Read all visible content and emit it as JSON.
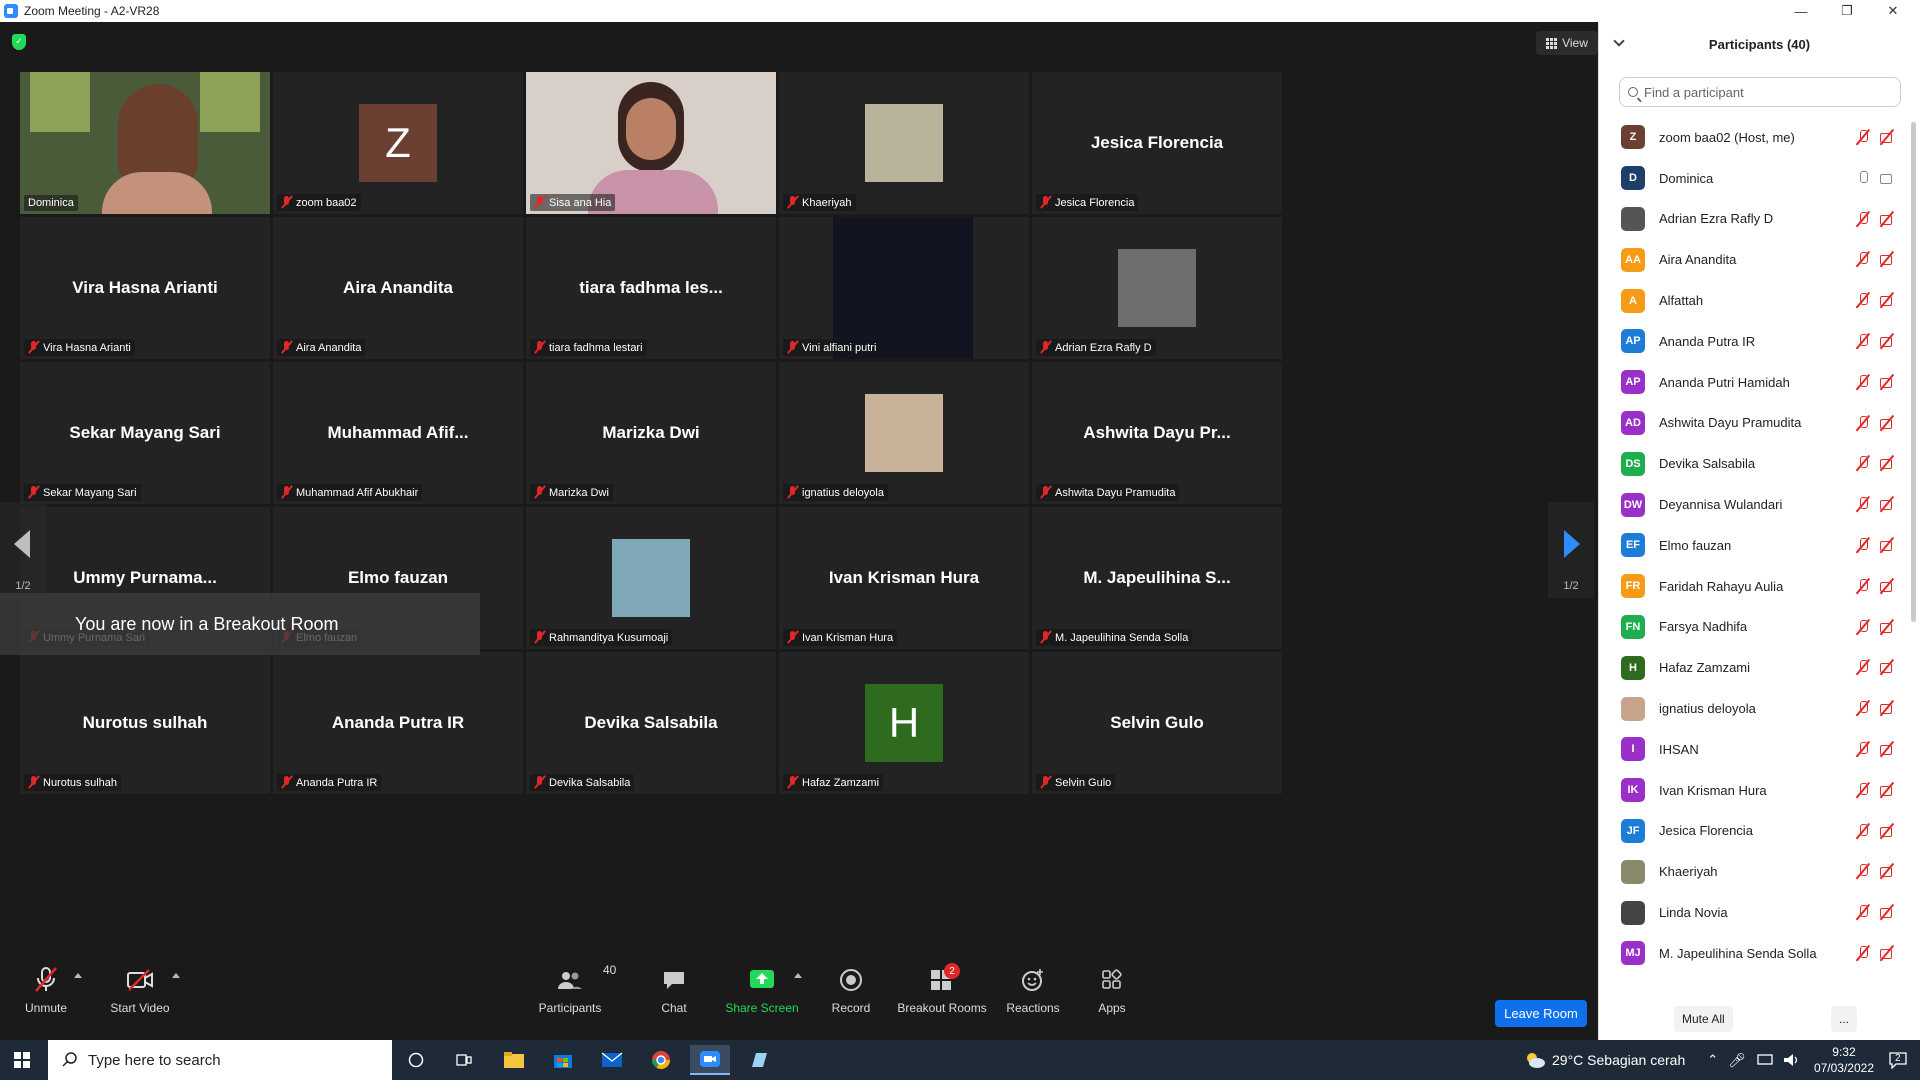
{
  "window": {
    "title": "Zoom Meeting - A2-VR28"
  },
  "meeting": {
    "view_label": "View",
    "page_indicator": "1/2",
    "toast": "You are now in a Breakout Room",
    "tiles": [
      {
        "big": "",
        "name": "Dominica",
        "kind": "video",
        "bg": "#4a5b3a",
        "active": true,
        "muted": false
      },
      {
        "big": "",
        "name": "zoom baa02",
        "kind": "letter",
        "letter": "Z",
        "bg": "#6b4033"
      },
      {
        "big": "",
        "name": "Sisa ana Hia",
        "kind": "video",
        "bg": "#d8cfc9"
      },
      {
        "big": "",
        "name": "Khaeriyah",
        "kind": "photo",
        "bg": "#b9b39c"
      },
      {
        "big": "Jesica Florencia",
        "name": "Jesica Florencia"
      },
      {
        "big": "Vira Hasna Arianti",
        "name": "Vira Hasna Arianti"
      },
      {
        "big": "Aira Anandita",
        "name": "Aira Anandita"
      },
      {
        "big": "tiara fadhma les...",
        "name": "tiara fadhma lestari"
      },
      {
        "big": "",
        "name": "Vini alfiani putri",
        "kind": "dark",
        "bg": "#121421"
      },
      {
        "big": "",
        "name": "Adrian Ezra Rafly D",
        "kind": "photo",
        "bg": "#6e6e6e"
      },
      {
        "big": "Sekar Mayang Sari",
        "name": "Sekar Mayang Sari"
      },
      {
        "big": "Muhammad  Afif...",
        "name": "Muhammad Afif Abukhair"
      },
      {
        "big": "Marizka Dwi",
        "name": "Marizka Dwi"
      },
      {
        "big": "",
        "name": "ignatius deloyola",
        "kind": "photo",
        "bg": "#c8b29a"
      },
      {
        "big": "Ashwita Dayu Pr...",
        "name": "Ashwita Dayu Pramudita"
      },
      {
        "big": "Ummy  Purnama...",
        "name": "Ummy Purnama Sari"
      },
      {
        "big": "Elmo fauzan",
        "name": "Elmo fauzan"
      },
      {
        "big": "",
        "name": "Rahmanditya Kusumoaji",
        "kind": "photo",
        "bg": "#7fa8b8"
      },
      {
        "big": "Ivan Krisman Hura",
        "name": "Ivan Krisman Hura"
      },
      {
        "big": "M. Japeulihina S...",
        "name": "M. Japeulihina Senda Solla"
      },
      {
        "big": "Nurotus sulhah",
        "name": "Nurotus sulhah"
      },
      {
        "big": "Ananda Putra IR",
        "name": "Ananda Putra IR"
      },
      {
        "big": "Devika Salsabila",
        "name": "Devika Salsabila"
      },
      {
        "big": "",
        "name": "Hafaz Zamzami",
        "kind": "letter",
        "letter": "H",
        "bg": "#2e6b1e"
      },
      {
        "big": "Selvin Gulo",
        "name": "Selvin Gulo"
      }
    ]
  },
  "toolbar": {
    "unmute": "Unmute",
    "start_video": "Start Video",
    "participants": "Participants",
    "participants_count": "40",
    "chat": "Chat",
    "share_screen": "Share Screen",
    "record": "Record",
    "breakout_rooms": "Breakout Rooms",
    "breakout_badge": "2",
    "reactions": "Reactions",
    "apps": "Apps",
    "leave_room": "Leave Room",
    "share_color": "#23d959",
    "leave_color": "#0e71eb"
  },
  "panel": {
    "title": "Participants (40)",
    "search_placeholder": "Find a participant",
    "mute_all": "Mute All",
    "more": "...",
    "participants": [
      {
        "initials": "Z",
        "name": "zoom baa02 (Host, me)",
        "color": "#6b4033",
        "status": "muted"
      },
      {
        "initials": "D",
        "name": "Dominica",
        "color": "#1f3f6b",
        "status": "on"
      },
      {
        "initials": "",
        "name": "Adrian Ezra Rafly D",
        "color": "#555555",
        "status": "muted",
        "photo": true
      },
      {
        "initials": "AA",
        "name": "Aira Anandita",
        "color": "#f59b16",
        "status": "muted"
      },
      {
        "initials": "A",
        "name": "Alfattah",
        "color": "#f59b16",
        "status": "muted"
      },
      {
        "initials": "AP",
        "name": "Ananda Putra IR",
        "color": "#1d7cd6",
        "status": "muted"
      },
      {
        "initials": "AP",
        "name": "Ananda Putri Hamidah",
        "color": "#9b30c9",
        "status": "muted"
      },
      {
        "initials": "AD",
        "name": "Ashwita Dayu Pramudita",
        "color": "#9b30c9",
        "status": "muted"
      },
      {
        "initials": "DS",
        "name": "Devika Salsabila",
        "color": "#1fae4f",
        "status": "muted"
      },
      {
        "initials": "DW",
        "name": "Deyannisa Wulandari",
        "color": "#9b30c9",
        "status": "muted"
      },
      {
        "initials": "EF",
        "name": "Elmo fauzan",
        "color": "#1d7cd6",
        "status": "muted"
      },
      {
        "initials": "FR",
        "name": "Faridah Rahayu Aulia",
        "color": "#f59b16",
        "status": "muted"
      },
      {
        "initials": "FN",
        "name": "Farsya Nadhifa",
        "color": "#1fae4f",
        "status": "muted"
      },
      {
        "initials": "H",
        "name": "Hafaz Zamzami",
        "color": "#2e6b1e",
        "status": "muted"
      },
      {
        "initials": "",
        "name": "ignatius deloyola",
        "color": "#c8a48a",
        "status": "muted",
        "photo": true
      },
      {
        "initials": "I",
        "name": "IHSAN",
        "color": "#9b30c9",
        "status": "muted"
      },
      {
        "initials": "IK",
        "name": "Ivan Krisman Hura",
        "color": "#9b30c9",
        "status": "muted"
      },
      {
        "initials": "JF",
        "name": "Jesica Florencia",
        "color": "#1d7cd6",
        "status": "muted"
      },
      {
        "initials": "",
        "name": "Khaeriyah",
        "color": "#8a8a6a",
        "status": "muted",
        "photo": true
      },
      {
        "initials": "",
        "name": "Linda Novia",
        "color": "#444444",
        "status": "muted",
        "photo": true
      },
      {
        "initials": "MJ",
        "name": "M. Japeulihina Senda Solla",
        "color": "#9b30c9",
        "status": "muted"
      }
    ]
  },
  "taskbar": {
    "search_placeholder": "Type here to search",
    "weather": "29°C  Sebagian cerah",
    "time": "9:32",
    "date": "07/03/2022",
    "notifications": "2"
  }
}
